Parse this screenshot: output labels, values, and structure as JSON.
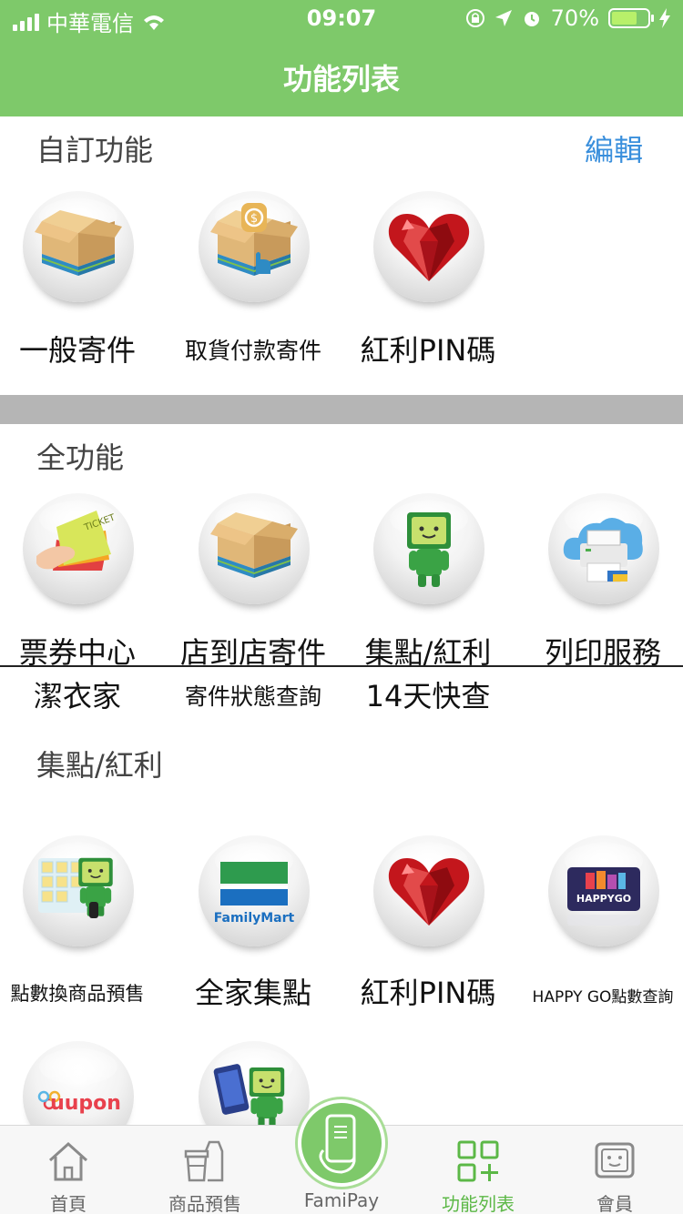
{
  "status_bar": {
    "carrier": "中華電信",
    "time": "09:07",
    "battery": "70%",
    "battery_level": 0.7
  },
  "header": {
    "title": "功能列表"
  },
  "custom": {
    "title": "自訂功能",
    "edit_label": "編輯",
    "items": [
      {
        "label": "一般寄件",
        "icon": "parcel-box-icon"
      },
      {
        "label": "取貨付款寄件",
        "icon": "cod-parcel-icon"
      },
      {
        "label": "紅利PIN碼",
        "icon": "ruby-heart-icon"
      }
    ]
  },
  "all": {
    "title": "全功能",
    "items": [
      {
        "label": "票券中心",
        "icon": "ticket-icon"
      },
      {
        "label": "店到店寄件",
        "icon": "parcel-box-icon"
      },
      {
        "label": "集點/紅利",
        "icon": "mascot-icon"
      },
      {
        "label": "列印服務",
        "icon": "cloud-printer-icon"
      },
      {
        "label": "潔衣家"
      },
      {
        "label": "寄件狀態查詢"
      },
      {
        "label": "14天快查"
      }
    ]
  },
  "points": {
    "title": "集點/紅利",
    "items": [
      {
        "label": "點數換商品預售",
        "icon": "mascot-gift-wall-icon"
      },
      {
        "label": "全家集點",
        "icon": "familymart-logo-icon",
        "logo_text": "FamilyMart"
      },
      {
        "label": "紅利PIN碼",
        "icon": "ruby-heart-icon"
      },
      {
        "label": "HAPPY GO點數查詢",
        "icon": "happygo-card-icon",
        "logo_text": "HAPPYGO"
      },
      {
        "icon": "uupon-logo-icon",
        "logo_text": "uupon"
      },
      {
        "icon": "mascot-phone-icon"
      }
    ]
  },
  "tabbar": {
    "items": [
      {
        "label": "首頁",
        "icon": "home-icon"
      },
      {
        "label": "商品預售",
        "icon": "cups-icon"
      },
      {
        "label": "FamiPay",
        "icon": "phone-hand-icon"
      },
      {
        "label": "功能列表",
        "icon": "grid-plus-icon"
      },
      {
        "label": "會員",
        "icon": "member-face-icon"
      }
    ],
    "active": "功能列表"
  },
  "colors": {
    "brand_green": "#7ec96a",
    "active_tab": "#5cb847",
    "link_blue": "#3a8fdc",
    "divider_gray": "#b5b5b5"
  }
}
